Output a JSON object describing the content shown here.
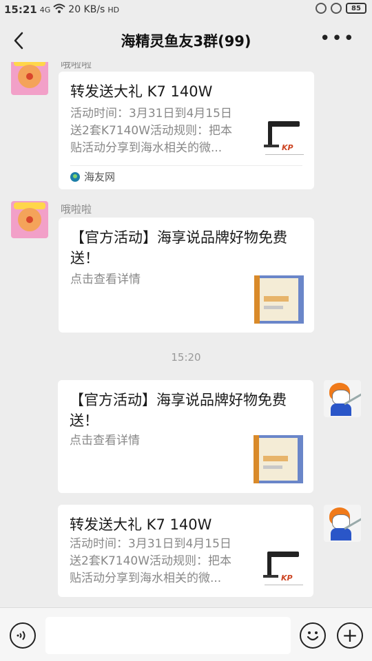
{
  "status_bar": {
    "time": "15:21",
    "signal": "4G",
    "net_speed": "20 KB/s",
    "hd": "HD",
    "battery": "85"
  },
  "header": {
    "title": "海精灵鱼友3群(99)",
    "more": "•••"
  },
  "messages": [
    {
      "sender": "哦啦啦",
      "title": "转发送大礼 K7 140W",
      "desc_lines": [
        "活动时间：3月31日到4月15日",
        "送2套K7140W活动规则：把本",
        "贴活动分享到海水相关的微..."
      ],
      "source": "海友网",
      "thumb_logo": "KP"
    },
    {
      "sender": "哦啦啦",
      "title": "【官方活动】海享说品牌好物免费送！",
      "desc": "点击查看详情"
    },
    {
      "timestamp": "15:20"
    },
    {
      "title": "【官方活动】海享说品牌好物免费送！",
      "desc": "点击查看详情"
    },
    {
      "title": "转发送大礼 K7 140W",
      "desc_lines": [
        "活动时间：3月31日到4月15日",
        "送2套K7140W活动规则：把本",
        "贴活动分享到海水相关的微..."
      ],
      "thumb_logo": "KP"
    }
  ],
  "input_bar": {
    "placeholder": "",
    "plus": "+"
  },
  "colors": {
    "background": "#ededed",
    "card": "#ffffff",
    "muted_text": "#888888"
  }
}
